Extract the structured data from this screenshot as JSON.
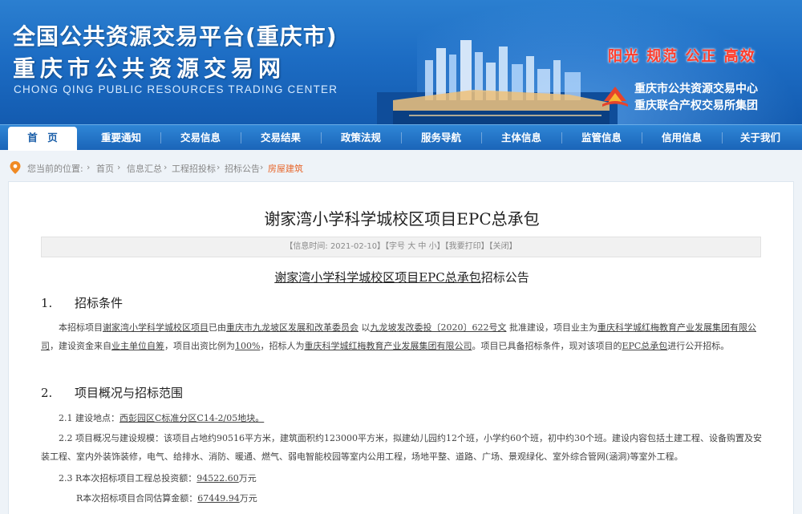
{
  "header": {
    "title_cn_1": "全国公共资源交易平台(重庆市)",
    "title_cn_2": "重庆市公共资源交易网",
    "title_en": "CHONG QING PUBLIC RESOURCES TRADING CENTER",
    "slogan": "阳光 规范 公正 高效",
    "org_1": "重庆市公共资源交易中心",
    "org_2": "重庆联合产权交易所集团"
  },
  "nav": {
    "items": [
      "首　页",
      "重要通知",
      "交易信息",
      "交易结果",
      "政策法规",
      "服务导航",
      "主体信息",
      "监管信息",
      "信用信息",
      "关于我们"
    ]
  },
  "breadcrumb": {
    "label": "您当前的位置:",
    "items": [
      "首页",
      "信息汇总",
      "工程招投标",
      "招标公告",
      "房屋建筑"
    ]
  },
  "article": {
    "title": "谢家湾小学科学城校区项目EPC总承包",
    "meta_time": "【信息时间: 2021-02-10】",
    "meta_font": "【字号 大 中 小】",
    "meta_print": "【我要打印】",
    "meta_close": "【关闭】",
    "notice_title_underlined": "谢家湾小学科学城校区项目EPC总承包",
    "notice_title_suffix": "招标公告",
    "section1_num": "1.",
    "section1_title": "招标条件",
    "p1": {
      "t1": "本招标项目",
      "project": "谢家湾小学科学城校区项目",
      "t2": "已由",
      "approver": "重庆市九龙坡区发展和改革委员会",
      "t3": " 以",
      "doc": "九龙坡发改委投〔2020〕622号文",
      "t4": "  批准建设，项目业主为",
      "owner": "重庆科学城红梅教育产业发展集团有限公司",
      "t5": "，建设资金来自",
      "fund": "业主单位自筹",
      "t6": "，项目出资比例为",
      "ratio": "100%",
      "t7": "，招标人为",
      "tenderer": "重庆科学城红梅教育产业发展集团有限公司",
      "t8": "。项目已具备招标条件，现对该项目的",
      "epc": "EPC总承包",
      "t9": "进行公开招标。"
    },
    "section2_num": "2.",
    "section2_title": "项目概况与招标范围",
    "s21_label": "2.1  建设地点：",
    "s21_value": "西彭园区C标准分区C14-2/05地块。",
    "s22_text": "2.2  项目概况与建设规模：该项目占地约90516平方米，建筑面积约123000平方米，拟建幼儿园约12个班，小学约60个班，初中约30个班。建设内容包括土建工程、设备购置及安装工程、室内外装饰装修，电气、给排水、消防、暖通、燃气、弱电智能校园等室内公用工程，场地平整、道路、广场、景观绿化、室外综合管网(涵洞)等室外工程。",
    "s23_label": "2.3  R本次招标项目工程总投资额：",
    "s23_value": "94522.60",
    "s23_unit": "万元",
    "s24_label": "R本次招标项目合同估算金额：",
    "s24_value": "67449.94",
    "s24_unit": "万元"
  }
}
